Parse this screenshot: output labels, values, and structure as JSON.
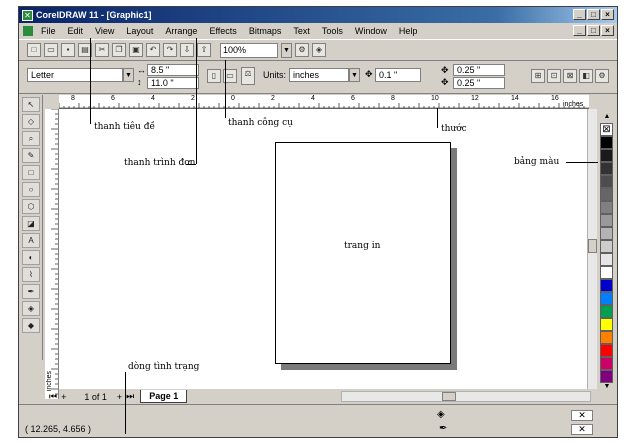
{
  "window": {
    "title": "CorelDRAW 11 - [Graphic1]",
    "buttons": [
      "_",
      "□",
      "×"
    ]
  },
  "menubar": {
    "items": [
      "File",
      "Edit",
      "View",
      "Layout",
      "Arrange",
      "Effects",
      "Bitmaps",
      "Text",
      "Tools",
      "Window",
      "Help"
    ]
  },
  "toolbar": {
    "zoom": "100%"
  },
  "property_bar": {
    "paper_size": "Letter",
    "width": "8.5 \"",
    "height": "11.0 \"",
    "units_label": "Units:",
    "units_value": "inches",
    "nudge": "0.1 \"",
    "dup_x": "0.25 \"",
    "dup_y": "0.25 \""
  },
  "rulers": {
    "unit_label": "inches",
    "h_ticks": [
      "8",
      "6",
      "4",
      "2",
      "0",
      "2",
      "4",
      "6",
      "8",
      "10",
      "12",
      "14",
      "16"
    ],
    "v_unit_label": "inches"
  },
  "page": {
    "label": "trang in"
  },
  "page_nav": {
    "counter": "1 of 1",
    "tab": "Page 1"
  },
  "status": {
    "coords": "( 12.265, 4.656 )"
  },
  "palette": {
    "colors": [
      "#000000",
      "#1a1a1a",
      "#333333",
      "#4d4d4d",
      "#666666",
      "#808080",
      "#999999",
      "#b3b3b3",
      "#cccccc",
      "#e6e6e6",
      "#ffffff",
      "#0000cc",
      "#0080ff",
      "#00a050",
      "#ffff00",
      "#ff8000",
      "#ff0000",
      "#cc0066",
      "#800080"
    ]
  },
  "annotations": {
    "title_bar": "thanh tiêu đề",
    "toolbar": "thanh công cụ",
    "ruler": "thước",
    "menu_bar": "thanh trình đơn",
    "palette": "bảng màu",
    "status_bar": "dòng tình trạng"
  }
}
